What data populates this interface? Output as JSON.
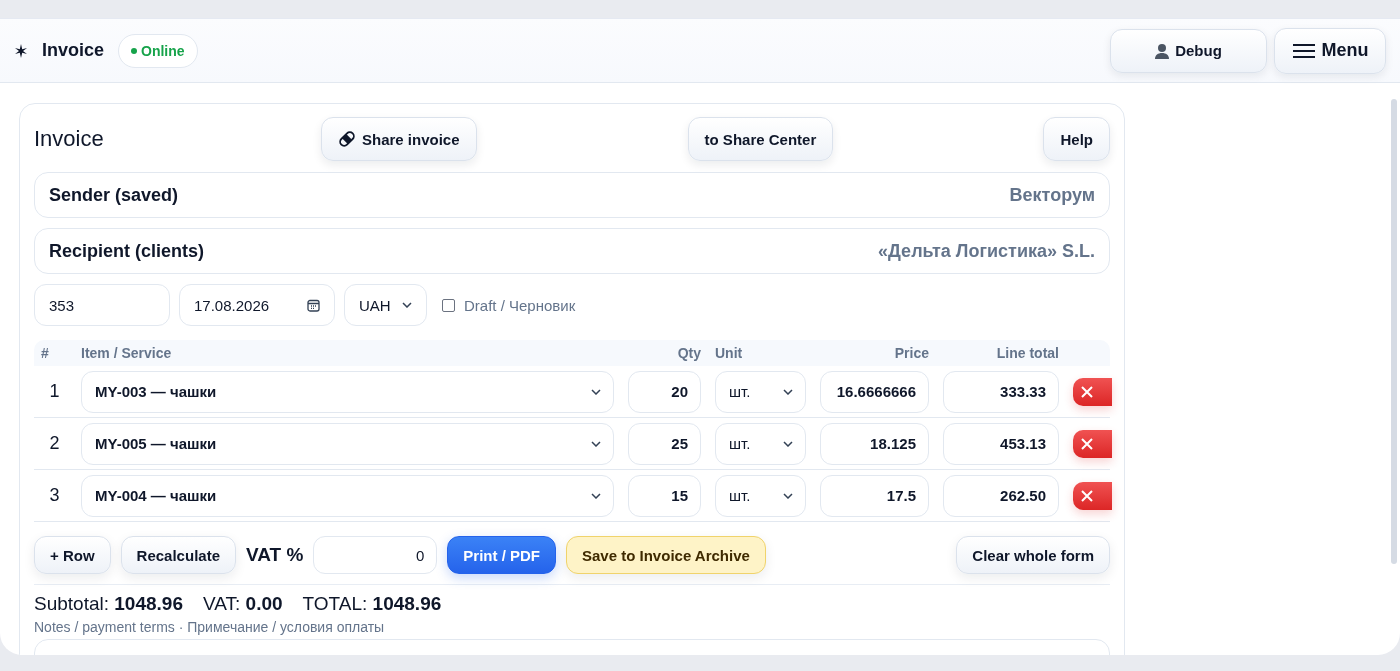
{
  "header": {
    "title": "Invoice",
    "status": "Online",
    "buttons": [
      {
        "kind": "debug",
        "label": "Debug"
      },
      {
        "kind": "menu",
        "label": "Menu"
      }
    ]
  },
  "invoice": {
    "title": "Invoice",
    "actions": [
      {
        "kind": "share",
        "label": "Share invoice"
      },
      {
        "kind": "plain",
        "label": "to Share Center"
      },
      {
        "kind": "help",
        "label": "Help"
      }
    ],
    "parties": [
      {
        "label": "Sender (saved)",
        "value": "Векторум"
      },
      {
        "label": "Recipient (clients)",
        "value": "«Дельта Логистика» S.L."
      }
    ],
    "number": "353",
    "date": "17.08.2026",
    "currency": "UAH",
    "draft": {
      "label": "Draft / Черновик",
      "checked": false
    },
    "table": {
      "columns": [
        "#",
        "Item / Service",
        "Qty",
        "Unit",
        "Price",
        "Line total"
      ],
      "rows": [
        {
          "number": "1",
          "item": "MY-003 — чашки",
          "qty": "20",
          "unit": "шт.",
          "price": "16.6666666",
          "total": "333.33"
        },
        {
          "number": "2",
          "item": "MY-005 — чашки",
          "qty": "25",
          "unit": "шт.",
          "price": "18.125",
          "total": "453.13"
        },
        {
          "number": "3",
          "item": "MY-004 — чашки",
          "qty": "15",
          "unit": "шт.",
          "price": "17.5",
          "total": "262.50"
        }
      ]
    },
    "toolbar": [
      {
        "kind": "plain",
        "label": "+ Row"
      },
      {
        "kind": "plain",
        "label": "Recalculate"
      },
      {
        "kind": "vat",
        "label": "VAT %",
        "value": "0"
      },
      {
        "kind": "primary",
        "label": "Print / PDF"
      },
      {
        "kind": "warning",
        "label": "Save to Invoice Archive"
      },
      {
        "kind": "right",
        "label": "Clear whole form"
      }
    ],
    "totals": [
      "Subtotal: **1048.96**",
      "VAT: **0.00**",
      "TOTAL: **1048.96**"
    ],
    "notes_label": "Notes / payment terms · Примечание / условия оплаты"
  }
}
